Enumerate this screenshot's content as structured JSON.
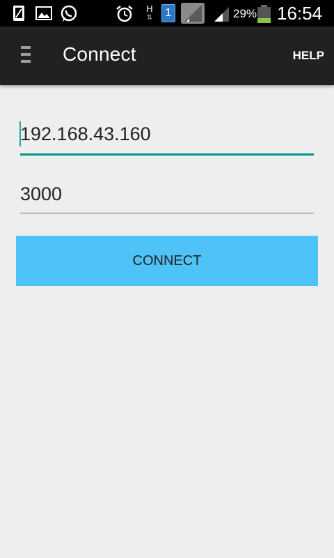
{
  "status_bar": {
    "icons": [
      "notification-phone-icon",
      "gallery-icon",
      "whatsapp-icon",
      "alarm-icon",
      "h-data-icon",
      "sim-1-icon",
      "no-signal-icon",
      "signal-icon",
      "battery-icon"
    ],
    "sim_label": "1",
    "data_label": "H",
    "battery_percent": "29%",
    "battery_level": 0.29,
    "time": "16:54"
  },
  "action_bar": {
    "title": "Connect",
    "help_label": "HELP"
  },
  "form": {
    "ip_value": "192.168.43.160",
    "port_value": "3000",
    "connect_label": "CONNECT"
  },
  "colors": {
    "accent": "#009688",
    "button": "#4fc3f7",
    "action_bar": "#212121",
    "background": "#eeeeee"
  }
}
